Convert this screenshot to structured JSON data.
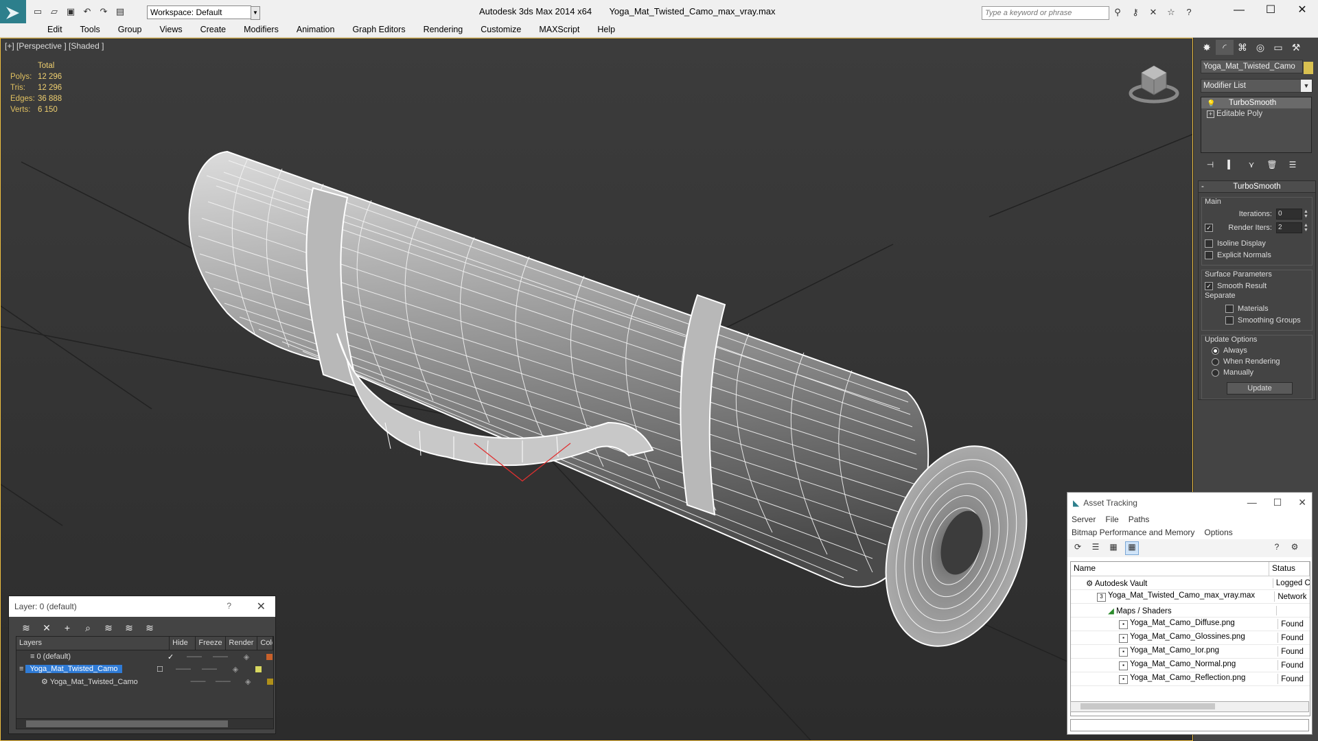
{
  "window": {
    "app": "Autodesk 3ds Max  2014 x64",
    "file": "Yoga_Mat_Twisted_Camo_max_vray.max",
    "workspace": "Workspace: Default",
    "search_placeholder": "Type a keyword or phrase"
  },
  "menu": [
    "Edit",
    "Tools",
    "Group",
    "Views",
    "Create",
    "Modifiers",
    "Animation",
    "Graph Editors",
    "Rendering",
    "Customize",
    "MAXScript",
    "Help"
  ],
  "viewport": {
    "label": "[+] [Perspective ] [Shaded ]",
    "stats": {
      "header": "Total",
      "rows": [
        {
          "k": "Polys:",
          "v": "12 296"
        },
        {
          "k": "Tris:",
          "v": "12 296"
        },
        {
          "k": "Edges:",
          "v": "36 888"
        },
        {
          "k": "Verts:",
          "v": "6 150"
        }
      ]
    }
  },
  "command_panel": {
    "object_name": "Yoga_Mat_Twisted_Camo",
    "object_color": "#d8c050",
    "modifier_list": "Modifier List",
    "stack": [
      "TurboSmooth",
      "Editable Poly"
    ],
    "rollout_title": "TurboSmooth",
    "main_group": "Main",
    "iterations_label": "Iterations:",
    "iterations_value": "0",
    "render_iters_label": "Render Iters:",
    "render_iters_value": "2",
    "isoline": "Isoline Display",
    "explicit_normals": "Explicit Normals",
    "surface_group": "Surface Parameters",
    "smooth_result": "Smooth Result",
    "separate": "Separate",
    "materials": "Materials",
    "smoothing_groups": "Smoothing Groups",
    "update_group": "Update Options",
    "always": "Always",
    "when_rendering": "When Rendering",
    "manually": "Manually",
    "update_button": "Update"
  },
  "layer_window": {
    "title": "Layer: 0 (default)",
    "help": "?",
    "columns": [
      "Layers",
      "Hide",
      "Freeze",
      "Render",
      "Colo"
    ],
    "rows": [
      {
        "name": "0 (default)",
        "color": "#c8602a"
      },
      {
        "name": "Yoga_Mat_Twisted_Camo",
        "color": "#d8d860"
      },
      {
        "name": "Yoga_Mat_Twisted_Camo",
        "color": "#b0901a"
      }
    ]
  },
  "asset_window": {
    "title": "Asset Tracking",
    "menu": [
      "Server",
      "File",
      "Paths",
      "Bitmap Performance and Memory",
      "Options"
    ],
    "columns": [
      "Name",
      "Status"
    ],
    "rows": [
      {
        "name": "Autodesk Vault",
        "status": "Logged C"
      },
      {
        "name": "Yoga_Mat_Twisted_Camo_max_vray.max",
        "status": "Network"
      },
      {
        "name": "Maps / Shaders",
        "status": ""
      },
      {
        "name": "Yoga_Mat_Camo_Diffuse.png",
        "status": "Found"
      },
      {
        "name": "Yoga_Mat_Camo_Glossines.png",
        "status": "Found"
      },
      {
        "name": "Yoga_Mat_Camo_Ior.png",
        "status": "Found"
      },
      {
        "name": "Yoga_Mat_Camo_Normal.png",
        "status": "Found"
      },
      {
        "name": "Yoga_Mat_Camo_Reflection.png",
        "status": "Found"
      }
    ]
  }
}
